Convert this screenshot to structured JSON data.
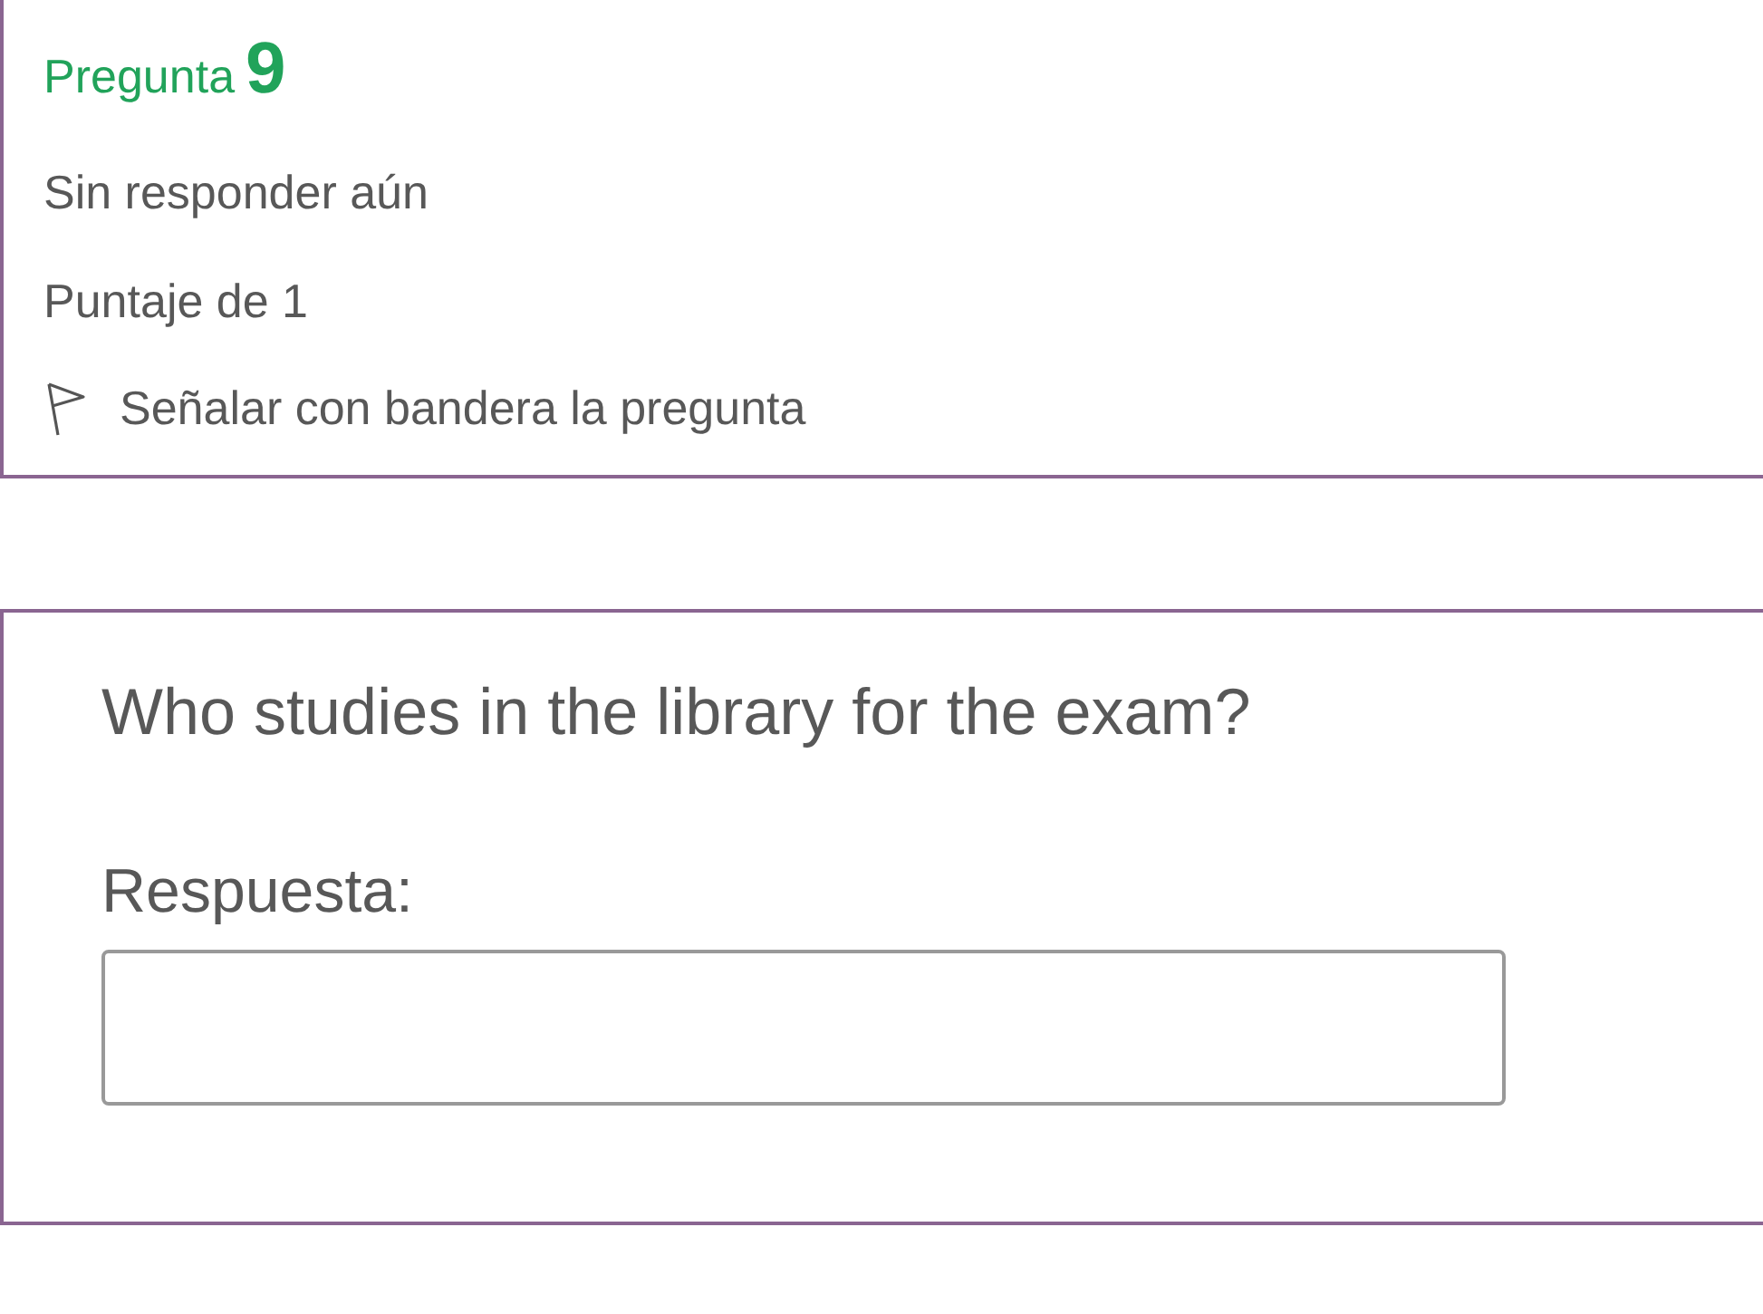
{
  "info": {
    "question_label": "Pregunta",
    "question_number": "9",
    "status": "Sin responder aún",
    "grade": "Puntaje de 1",
    "flag": {
      "label": "Señalar con bandera la pregunta",
      "flagged": false
    }
  },
  "content": {
    "question_text": "Who studies in the library for the exam?",
    "answer_label": "Respuesta:"
  }
}
